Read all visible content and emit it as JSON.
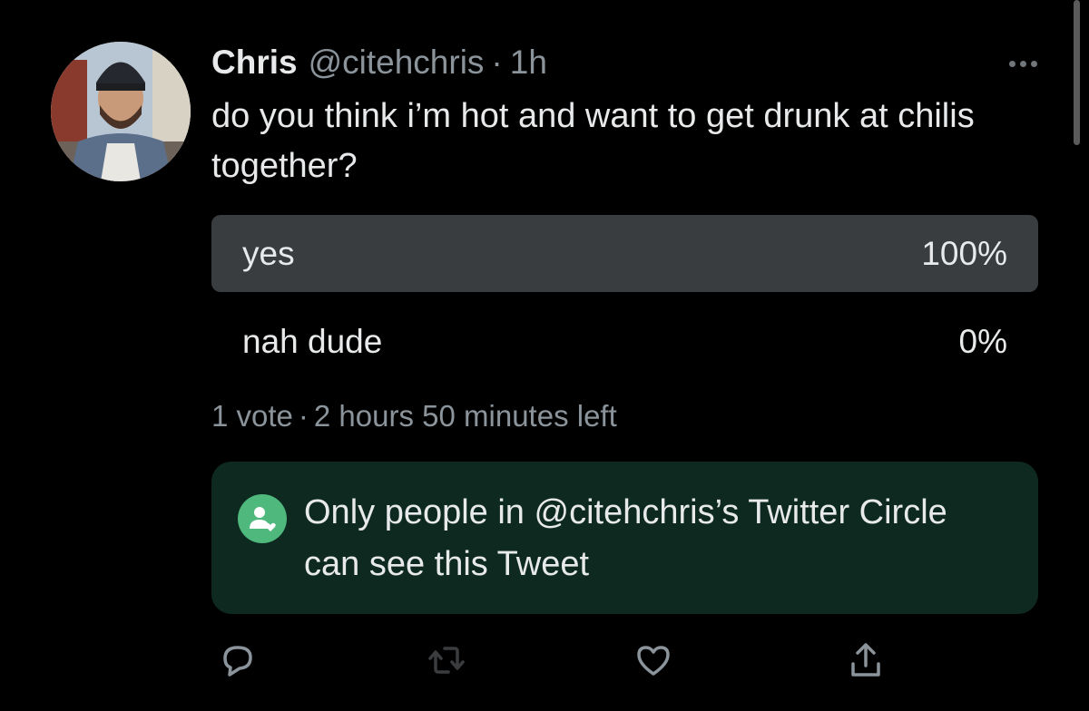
{
  "tweet": {
    "author_name": "Chris",
    "author_handle": "@citehchris",
    "separator": "·",
    "time": "1h",
    "text": "do you think i’m hot and want to get drunk at chilis together?",
    "more_icon": "more-dots-icon"
  },
  "poll": {
    "options": [
      {
        "label": "yes",
        "percent_text": "100%",
        "percent": 100
      },
      {
        "label": "nah dude",
        "percent_text": "0%",
        "percent": 0
      }
    ],
    "votes": "1 vote",
    "meta_separator": "·",
    "time_left": "2 hours 50 minutes left"
  },
  "circle_notice": {
    "text": "Only people in @citehchris’s Twitter Circle can see this Tweet",
    "icon": "twitter-circle-icon",
    "background_color": "#0e2a20",
    "icon_color": "#4eb87d"
  },
  "actions": [
    {
      "name": "reply-button",
      "icon": "reply-icon"
    },
    {
      "name": "retweet-button",
      "icon": "retweet-icon"
    },
    {
      "name": "like-button",
      "icon": "heart-icon"
    },
    {
      "name": "share-button",
      "icon": "share-icon"
    }
  ],
  "colors": {
    "background": "#000000",
    "text_primary": "#e7e9ea",
    "text_secondary": "#8b949b",
    "poll_fill": "#3a3d40"
  }
}
